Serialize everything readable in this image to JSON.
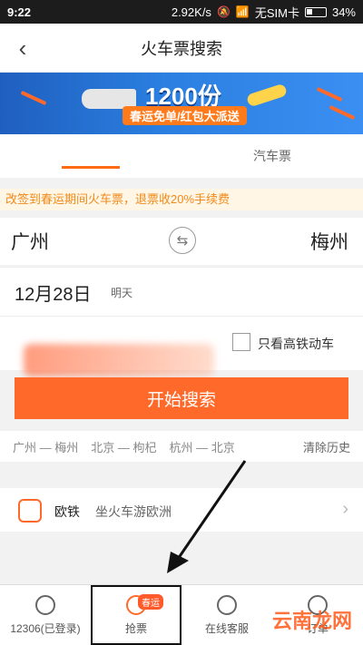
{
  "status_bar": {
    "time": "9:22",
    "speed": "2.92K/s",
    "sim": "无SIM卡",
    "battery": "34%"
  },
  "header": {
    "title": "火车票搜索"
  },
  "banner": {
    "headline": "1200份",
    "subline": "春运免单/红包大派送"
  },
  "tabs": [
    {
      "label": "",
      "active": true
    },
    {
      "label": "汽车票",
      "active": false
    }
  ],
  "notice": {
    "text": "改签到春运期间火车票，退票收20%手续费"
  },
  "route": {
    "from": "广州",
    "to": "梅州"
  },
  "date": {
    "value": "12月28日",
    "note": "明天"
  },
  "filter": {
    "label": "只看高铁动车"
  },
  "search_button": {
    "label": "开始搜索"
  },
  "history": {
    "items": [
      "广州 — 梅州",
      "北京 — 枸杞",
      "杭州 — 北京"
    ],
    "clear": "清除历史"
  },
  "promo": {
    "title": "欧铁",
    "subtitle": "坐火车游欧洲"
  },
  "bottom_nav": {
    "items": [
      {
        "label": "12306(已登录)"
      },
      {
        "label": "抢票",
        "badge": "春运"
      },
      {
        "label": "在线客服"
      },
      {
        "label": "订单"
      }
    ]
  },
  "watermark": "云南龙网",
  "colors": {
    "accent": "#ff6a2a",
    "notice_text": "#f18a1a"
  }
}
